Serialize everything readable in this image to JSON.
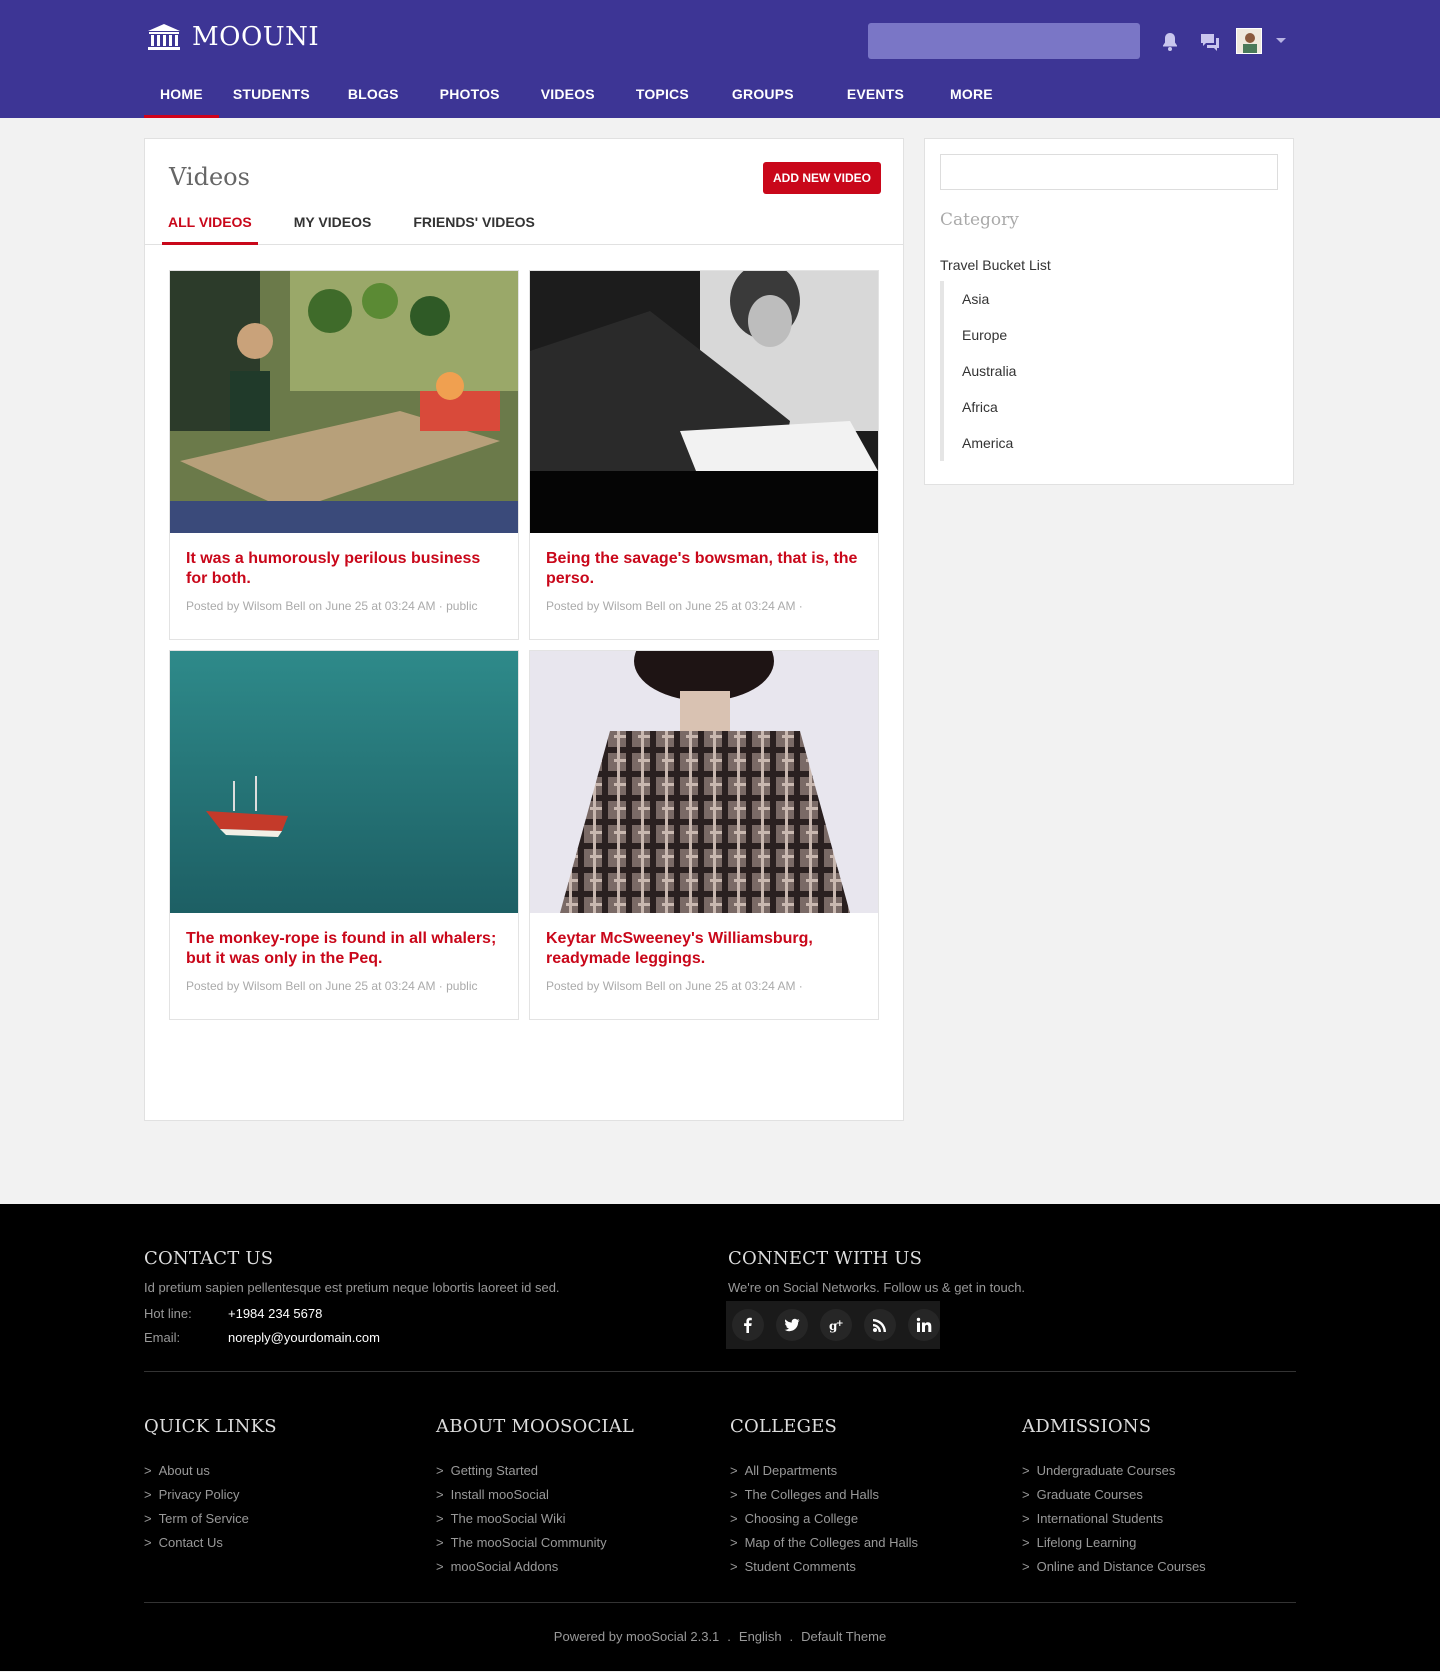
{
  "header": {
    "logo_text": "MOOUNI",
    "nav": [
      "HOME",
      "STUDENTS",
      "BLOGS",
      "PHOTOS",
      "VIDEOS",
      "TOPICS",
      "GROUPS",
      "EVENTS",
      "MORE"
    ],
    "active_nav": "HOME",
    "accent": "#3d3595"
  },
  "videos": {
    "title": "Videos",
    "add_button": "ADD NEW VIDEO",
    "tabs": [
      "ALL VIDEOS",
      "MY VIDEOS",
      "FRIENDS' VIDEOS"
    ],
    "active_tab": "ALL VIDEOS",
    "items": [
      {
        "title": "It was a humorously perilous business for both.",
        "meta": "Posted by Wilsom Bell on June 25 at 03:24 AM · public"
      },
      {
        "title": "Being the savage's bowsman, that is, the perso.",
        "meta": "Posted by Wilsom Bell on June 25 at 03:24 AM ·"
      },
      {
        "title": "The monkey-rope is found in all whalers; but it was only in the Peq.",
        "meta": "Posted by Wilsom Bell on June 25 at 03:24 AM · public"
      },
      {
        "title": "Keytar McSweeney's Williamsburg, readymade leggings.",
        "meta": "Posted by Wilsom Bell on June 25 at 03:24 AM ·"
      }
    ]
  },
  "sidebar": {
    "title": "Category",
    "root": "Travel Bucket List",
    "categories": [
      "Asia",
      "Europe",
      "Australia",
      "Africa",
      "America"
    ]
  },
  "footer": {
    "contact": {
      "title": "CONTACT US",
      "text": "Id pretium sapien pellentesque est pretium neque lobortis laoreet id sed.",
      "hotline_label": "Hot line:",
      "hotline": "+1984 234 5678",
      "email_label": "Email:",
      "email": "noreply@yourdomain.com"
    },
    "connect": {
      "title": "CONNECT WITH US",
      "text": "We're on Social Networks. Follow us & get in touch."
    },
    "columns": [
      {
        "title": "QUICK LINKS",
        "links": [
          "About us",
          "Privacy Policy",
          "Term of Service",
          "Contact Us"
        ]
      },
      {
        "title": "ABOUT MOOSOCIAL",
        "links": [
          "Getting Started",
          "Install mooSocial",
          "The mooSocial Wiki",
          "The mooSocial Community",
          "mooSocial Addons"
        ]
      },
      {
        "title": "COLLEGES",
        "links": [
          "All Departments",
          "The Colleges and Halls",
          "Choosing a College",
          "Map of the Colleges and Halls",
          "Student Comments"
        ]
      },
      {
        "title": "ADMISSIONS",
        "links": [
          "Undergraduate Courses",
          "Graduate Courses",
          "International Students",
          "Lifelong Learning",
          "Online and Distance Courses"
        ]
      }
    ],
    "bottom": {
      "powered": "Powered by mooSocial 2.3.1",
      "language": "English",
      "theme": "Default Theme"
    }
  }
}
